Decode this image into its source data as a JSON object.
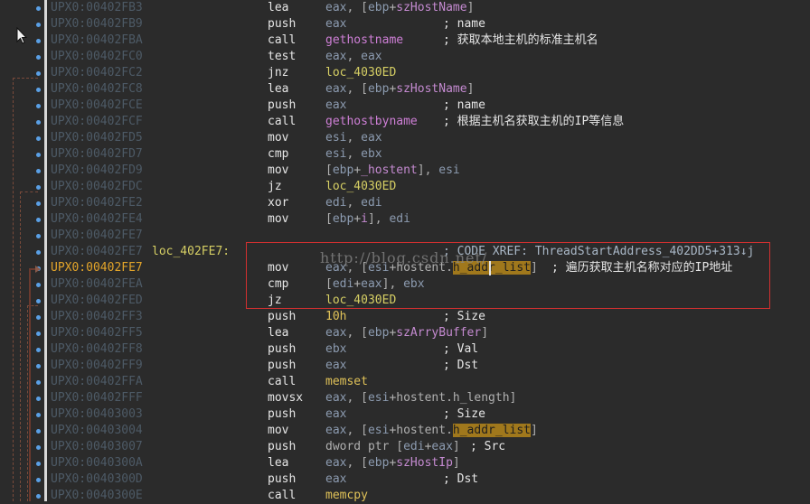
{
  "disassembly": {
    "rows": [
      {
        "address": "UPX0:00402FB3",
        "label": "",
        "mnemonic": "lea",
        "operands": "eax, [ebp+szHostName]",
        "comment": ""
      },
      {
        "address": "UPX0:00402FB9",
        "label": "",
        "mnemonic": "push",
        "operands": "eax",
        "comment": "; name"
      },
      {
        "address": "UPX0:00402FBA",
        "label": "",
        "mnemonic": "call",
        "operands": "gethostname",
        "comment": "; 获取本地主机的标准主机名"
      },
      {
        "address": "UPX0:00402FC0",
        "label": "",
        "mnemonic": "test",
        "operands": "eax, eax",
        "comment": ""
      },
      {
        "address": "UPX0:00402FC2",
        "label": "",
        "mnemonic": "jnz",
        "operands": "loc_4030ED",
        "comment": ""
      },
      {
        "address": "UPX0:00402FC8",
        "label": "",
        "mnemonic": "lea",
        "operands": "eax, [ebp+szHostName]",
        "comment": ""
      },
      {
        "address": "UPX0:00402FCE",
        "label": "",
        "mnemonic": "push",
        "operands": "eax",
        "comment": "; name"
      },
      {
        "address": "UPX0:00402FCF",
        "label": "",
        "mnemonic": "call",
        "operands": "gethostbyname",
        "comment": "; 根据主机名获取主机的IP等信息"
      },
      {
        "address": "UPX0:00402FD5",
        "label": "",
        "mnemonic": "mov",
        "operands": "esi, eax",
        "comment": ""
      },
      {
        "address": "UPX0:00402FD7",
        "label": "",
        "mnemonic": "cmp",
        "operands": "esi, ebx",
        "comment": ""
      },
      {
        "address": "UPX0:00402FD9",
        "label": "",
        "mnemonic": "mov",
        "operands": "[ebp+_hostent], esi",
        "comment": ""
      },
      {
        "address": "UPX0:00402FDC",
        "label": "",
        "mnemonic": "jz",
        "operands": "loc_4030ED",
        "comment": ""
      },
      {
        "address": "UPX0:00402FE2",
        "label": "",
        "mnemonic": "xor",
        "operands": "edi, edi",
        "comment": ""
      },
      {
        "address": "UPX0:00402FE4",
        "label": "",
        "mnemonic": "mov",
        "operands": "[ebp+i], edi",
        "comment": ""
      },
      {
        "address": "UPX0:00402FE7",
        "label": "",
        "mnemonic": "",
        "operands": "",
        "comment": ""
      },
      {
        "address": "UPX0:00402FE7",
        "label": "loc_402FE7:",
        "mnemonic": "",
        "operands": "",
        "comment": "; CODE XREF: ThreadStartAddress_402DD5+313↓j"
      },
      {
        "address": "UPX0:00402FE7",
        "label": "",
        "mnemonic": "mov",
        "operands": "eax, [esi+hostent.h_addr_list]",
        "comment": "; 遍历获取主机名称对应的IP地址"
      },
      {
        "address": "UPX0:00402FEA",
        "label": "",
        "mnemonic": "cmp",
        "operands": "[edi+eax], ebx",
        "comment": ""
      },
      {
        "address": "UPX0:00402FED",
        "label": "",
        "mnemonic": "jz",
        "operands": "loc_4030ED",
        "comment": ""
      },
      {
        "address": "UPX0:00402FF3",
        "label": "",
        "mnemonic": "push",
        "operands": "10h",
        "comment": "; Size"
      },
      {
        "address": "UPX0:00402FF5",
        "label": "",
        "mnemonic": "lea",
        "operands": "eax, [ebp+szArryBuffer]",
        "comment": ""
      },
      {
        "address": "UPX0:00402FF8",
        "label": "",
        "mnemonic": "push",
        "operands": "ebx",
        "comment": "; Val"
      },
      {
        "address": "UPX0:00402FF9",
        "label": "",
        "mnemonic": "push",
        "operands": "eax",
        "comment": "; Dst"
      },
      {
        "address": "UPX0:00402FFA",
        "label": "",
        "mnemonic": "call",
        "operands": "memset",
        "comment": ""
      },
      {
        "address": "UPX0:00402FFF",
        "label": "",
        "mnemonic": "movsx",
        "operands": "eax, [esi+hostent.h_length]",
        "comment": ""
      },
      {
        "address": "UPX0:00403003",
        "label": "",
        "mnemonic": "push",
        "operands": "eax",
        "comment": "; Size"
      },
      {
        "address": "UPX0:00403004",
        "label": "",
        "mnemonic": "mov",
        "operands": "eax, [esi+hostent.h_addr_list]",
        "comment": ""
      },
      {
        "address": "UPX0:00403007",
        "label": "",
        "mnemonic": "push",
        "operands": "dword ptr [edi+eax]",
        "comment": "; Src"
      },
      {
        "address": "UPX0:0040300A",
        "label": "",
        "mnemonic": "lea",
        "operands": "eax, [ebp+szHostIp]",
        "comment": ""
      },
      {
        "address": "UPX0:0040300D",
        "label": "",
        "mnemonic": "push",
        "operands": "eax",
        "comment": "; Dst"
      },
      {
        "address": "UPX0:0040300E",
        "label": "",
        "mnemonic": "call",
        "operands": "memcpy",
        "comment": ""
      }
    ],
    "current_address_index": 16,
    "highlight_token": "h_addr_list"
  },
  "watermark": "http://blog.csdn.net/",
  "colors": {
    "background": "#2b2b2b",
    "address": "#4d5a66",
    "current_address": "#e2a42a",
    "label": "#d6cf64",
    "highlight": "#a0781c",
    "selection_box": "#d23030",
    "breakpoint_dot": "#5aa0e6"
  }
}
